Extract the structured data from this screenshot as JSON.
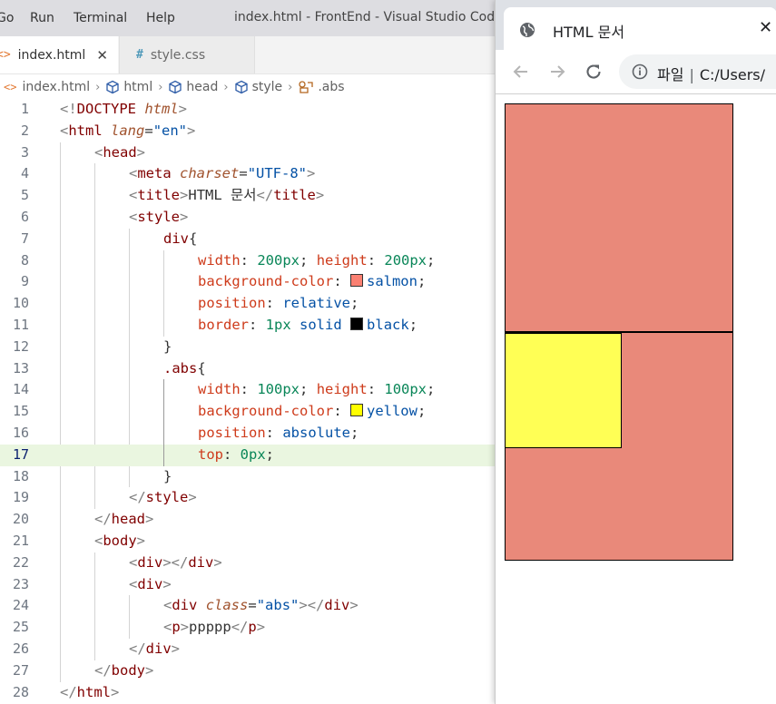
{
  "vscode": {
    "menu": [
      "Go",
      "Run",
      "Terminal",
      "Help"
    ],
    "window_title": "index.html - FrontEnd - Visual Studio Code",
    "tabs": [
      {
        "label": "index.html",
        "icon": "<>",
        "close": "✕"
      },
      {
        "label": "style.css",
        "icon": "#"
      }
    ],
    "breadcrumb": [
      "index.html",
      "html",
      "head",
      "style",
      ".abs"
    ],
    "colors": {
      "salmon": "#fa8072",
      "black": "#000000",
      "yellow": "#ffff00",
      "current_line": "#eaf6e0"
    }
  },
  "code_lines": [
    {
      "n": "1",
      "text": "<!DOCTYPE html>"
    },
    {
      "n": "2",
      "text": "<html lang=\"en\">"
    },
    {
      "n": "3",
      "text": "<head>"
    },
    {
      "n": "4",
      "text": "<meta charset=\"UTF-8\">"
    },
    {
      "n": "5",
      "text": "<title>HTML 문서</title>"
    },
    {
      "n": "6",
      "text": "<style>"
    },
    {
      "n": "7",
      "text": "div{"
    },
    {
      "n": "8",
      "text": "width: 200px; height: 200px;"
    },
    {
      "n": "9",
      "text": "background-color: salmon;"
    },
    {
      "n": "10",
      "text": "position: relative;"
    },
    {
      "n": "11",
      "text": "border: 1px solid black;"
    },
    {
      "n": "12",
      "text": "}"
    },
    {
      "n": "13",
      "text": ".abs{"
    },
    {
      "n": "14",
      "text": "width: 100px; height: 100px;"
    },
    {
      "n": "15",
      "text": "background-color: yellow;"
    },
    {
      "n": "16",
      "text": "position: absolute;"
    },
    {
      "n": "17",
      "text": "top: 0px;"
    },
    {
      "n": "18",
      "text": "}"
    },
    {
      "n": "19",
      "text": "</style>"
    },
    {
      "n": "20",
      "text": "</head>"
    },
    {
      "n": "21",
      "text": "<body>"
    },
    {
      "n": "22",
      "text": "<div></div>"
    },
    {
      "n": "23",
      "text": "<div>"
    },
    {
      "n": "24",
      "text": "<div class=\"abs\"></div>"
    },
    {
      "n": "25",
      "text": "<p>ppppp</p>"
    },
    {
      "n": "26",
      "text": "</div>"
    },
    {
      "n": "27",
      "text": "</body>"
    },
    {
      "n": "28",
      "text": "</html>"
    }
  ],
  "browser": {
    "tab_title": "HTML 문서",
    "tab_close": "✕",
    "address_label": "파일",
    "address_text": "C:/Users/",
    "page_colors": {
      "salmon": "#e9897a",
      "yellow": "#ffff55"
    }
  }
}
